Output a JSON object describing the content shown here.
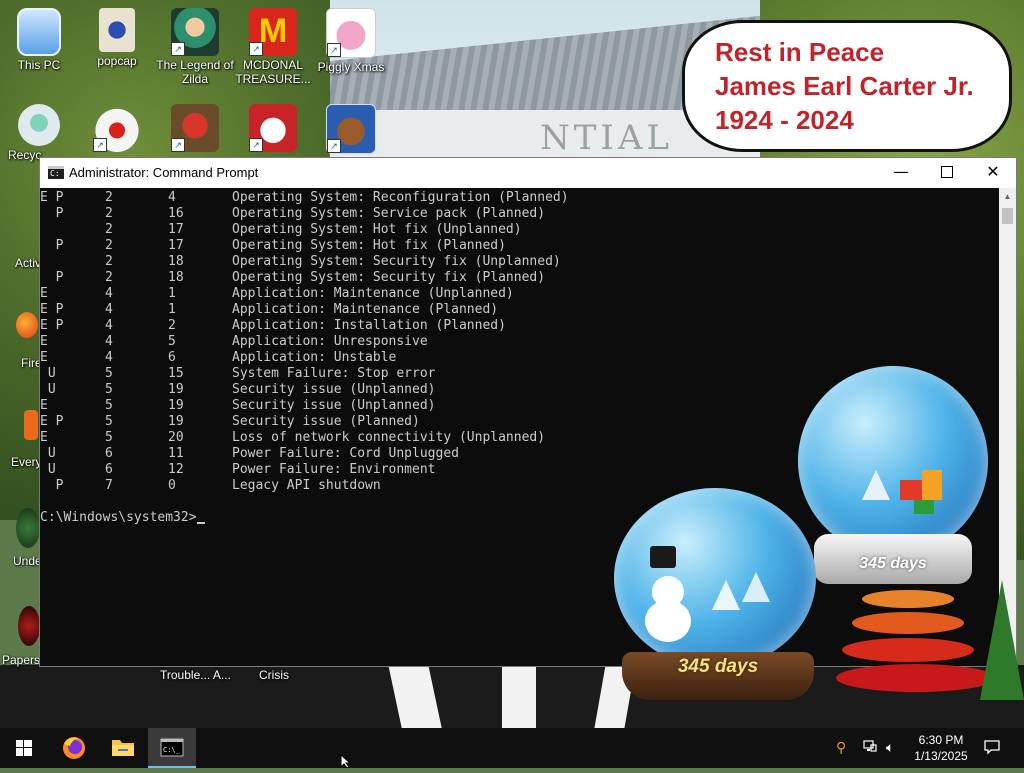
{
  "tribute": {
    "line1": "Rest in Peace",
    "line2": "James Earl Carter Jr.",
    "line3": "1924 - 2024"
  },
  "wallpaper": {
    "building_text": "NTIAL"
  },
  "desktop_icons": [
    {
      "label": "This PC",
      "icon": "computer-icon"
    },
    {
      "label": "popcap",
      "icon": "popcap-icon"
    },
    {
      "label": "The Legend of Zilda",
      "icon": "zilda-icon"
    },
    {
      "label": "MCDONAL TREASURE...",
      "icon": "mcdonalds-icon"
    },
    {
      "label": "Piggly Xmas",
      "icon": "pig-icon"
    },
    {
      "label": "Recyc",
      "icon": "recycle-bin-icon"
    },
    {
      "label": "",
      "icon": "chicken-icon"
    },
    {
      "label": "",
      "icon": "angry-bird-icon"
    },
    {
      "label": "",
      "icon": "snowman-game-icon"
    },
    {
      "label": "",
      "icon": "teddy-bear-icon"
    }
  ],
  "partial_labels": {
    "activ": "Activ",
    "fire": "Fire",
    "every": "Every",
    "unde": "Unde",
    "papers": "Papers",
    "trouble": "Trouble... A...",
    "crisis": "Crisis"
  },
  "cmd": {
    "title": "Administrator: Command Prompt",
    "rows": [
      {
        "flags": "E P",
        "major": "2",
        "minor": "4",
        "desc": "Operating System: Reconfiguration (Planned)"
      },
      {
        "flags": "  P",
        "major": "2",
        "minor": "16",
        "desc": "Operating System: Service pack (Planned)"
      },
      {
        "flags": "",
        "major": "2",
        "minor": "17",
        "desc": "Operating System: Hot fix (Unplanned)"
      },
      {
        "flags": "  P",
        "major": "2",
        "minor": "17",
        "desc": "Operating System: Hot fix (Planned)"
      },
      {
        "flags": "",
        "major": "2",
        "minor": "18",
        "desc": "Operating System: Security fix (Unplanned)"
      },
      {
        "flags": "  P",
        "major": "2",
        "minor": "18",
        "desc": "Operating System: Security fix (Planned)"
      },
      {
        "flags": "E",
        "major": "4",
        "minor": "1",
        "desc": "Application: Maintenance (Unplanned)"
      },
      {
        "flags": "E P",
        "major": "4",
        "minor": "1",
        "desc": "Application: Maintenance (Planned)"
      },
      {
        "flags": "E P",
        "major": "4",
        "minor": "2",
        "desc": "Application: Installation (Planned)"
      },
      {
        "flags": "E",
        "major": "4",
        "minor": "5",
        "desc": "Application: Unresponsive"
      },
      {
        "flags": "E",
        "major": "4",
        "minor": "6",
        "desc": "Application: Unstable"
      },
      {
        "flags": " U",
        "major": "5",
        "minor": "15",
        "desc": "System Failure: Stop error"
      },
      {
        "flags": " U",
        "major": "5",
        "minor": "19",
        "desc": "Security issue (Unplanned)"
      },
      {
        "flags": "E",
        "major": "5",
        "minor": "19",
        "desc": "Security issue (Unplanned)"
      },
      {
        "flags": "E P",
        "major": "5",
        "minor": "19",
        "desc": "Security issue (Planned)"
      },
      {
        "flags": "E",
        "major": "5",
        "minor": "20",
        "desc": "Loss of network connectivity (Unplanned)"
      },
      {
        "flags": " U",
        "major": "6",
        "minor": "11",
        "desc": "Power Failure: Cord Unplugged"
      },
      {
        "flags": " U",
        "major": "6",
        "minor": "12",
        "desc": "Power Failure: Environment"
      },
      {
        "flags": "  P",
        "major": "7",
        "minor": "0",
        "desc": "Legacy API shutdown"
      }
    ],
    "prompt": "C:\\Windows\\system32>"
  },
  "globes": {
    "left_days": "345 days",
    "right_days": "345 days"
  },
  "taskbar": {
    "time": "6:30 PM",
    "date": "1/13/2025",
    "pinned": [
      {
        "name": "start-button",
        "icon": "windows-logo-icon"
      },
      {
        "name": "firefox-button",
        "icon": "firefox-icon"
      },
      {
        "name": "file-explorer-button",
        "icon": "folder-icon"
      },
      {
        "name": "command-prompt-button",
        "icon": "cmd-icon"
      }
    ]
  },
  "colors": {
    "tribute_red": "#c0232a",
    "console_bg": "#0c0c0c",
    "console_text": "#cccccc",
    "taskbar_bg": "#101010"
  }
}
